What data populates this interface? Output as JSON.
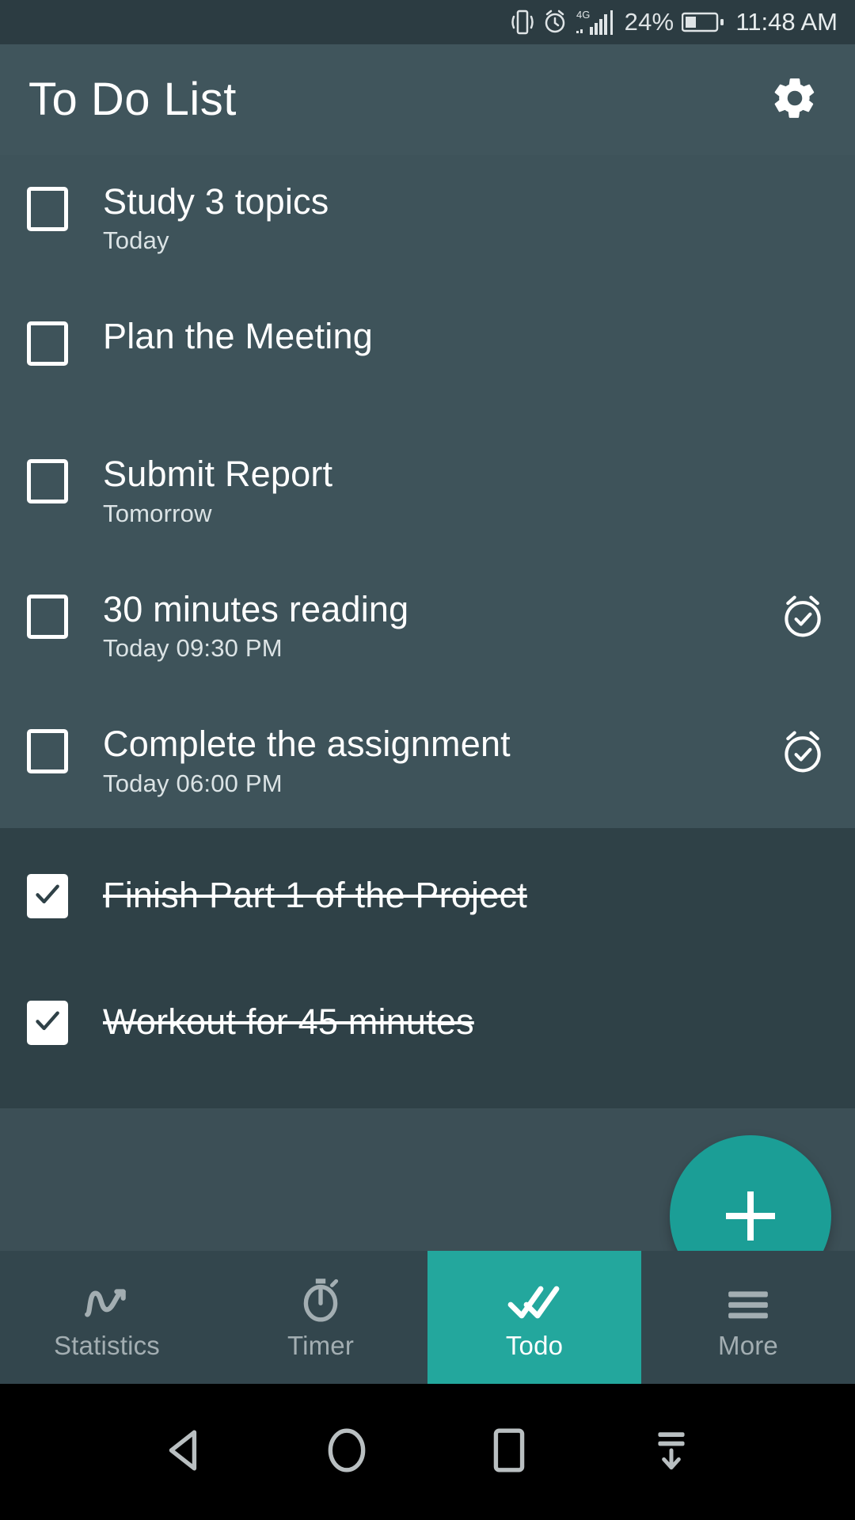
{
  "statusbar": {
    "icons": [
      "vibrate-icon",
      "alarm-icon",
      "signal-4g-icon",
      "battery-icon"
    ],
    "network_label": "4G",
    "battery_percent": "24%",
    "time": "11:48 AM"
  },
  "appbar": {
    "title": "To Do List",
    "settings_icon": "gear-icon"
  },
  "tasks": {
    "pending": [
      {
        "title": "Study 3 topics",
        "subtitle": "Today",
        "checked": false,
        "alarm": false
      },
      {
        "title": "Plan the Meeting",
        "subtitle": "",
        "checked": false,
        "alarm": false
      },
      {
        "title": "Submit Report",
        "subtitle": "Tomorrow",
        "checked": false,
        "alarm": false
      },
      {
        "title": "30 minutes reading",
        "subtitle": "Today  09:30 PM",
        "checked": false,
        "alarm": true
      },
      {
        "title": "Complete the assignment",
        "subtitle": "Today  06:00 PM",
        "checked": false,
        "alarm": true
      }
    ],
    "completed": [
      {
        "title": "Finish Part 1 of the Project",
        "subtitle": "",
        "checked": true,
        "alarm": false
      },
      {
        "title": "Workout for 45 minutes",
        "subtitle": "",
        "checked": true,
        "alarm": false
      }
    ]
  },
  "fab": {
    "label": "+",
    "icon": "plus-icon",
    "color": "#1b9e96"
  },
  "bottomnav": {
    "active_index": 2,
    "active_color": "#23a79d",
    "items": [
      {
        "label": "Statistics",
        "icon": "chart-line-icon"
      },
      {
        "label": "Timer",
        "icon": "stopwatch-icon"
      },
      {
        "label": "Todo",
        "icon": "double-check-icon"
      },
      {
        "label": "More",
        "icon": "hamburger-icon"
      }
    ]
  },
  "sysnav": {
    "items": [
      {
        "icon": "back-triangle-icon"
      },
      {
        "icon": "home-circle-icon"
      },
      {
        "icon": "recents-square-icon"
      },
      {
        "icon": "hide-navbar-icon"
      }
    ]
  }
}
